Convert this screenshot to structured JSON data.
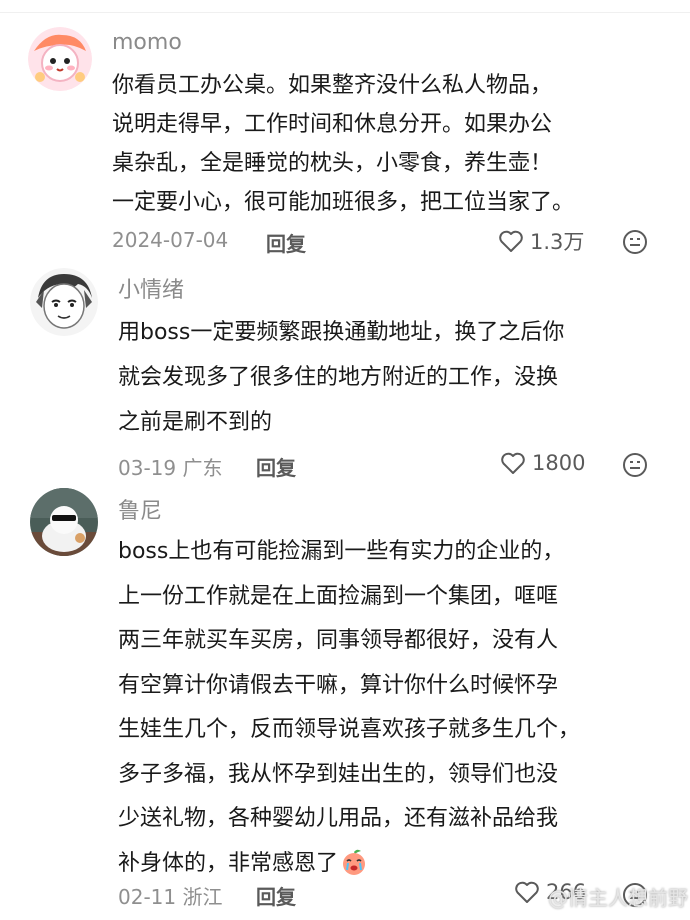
{
  "comments": [
    {
      "username": "momo",
      "lines": [
        "你看员工办公桌。如果整齐没什么私人物品，",
        "说明走得早，工作时间和休息分开。如果办公",
        "桌杂乱，全是睡觉的枕头，小零食，养生壶！",
        "一定要小心，很可能加班很多，把工位当家了。"
      ],
      "meta": "2024-07-04",
      "reply_label": "回复",
      "likes": "1.3万"
    },
    {
      "username": "小情绪",
      "lines": [
        "用boss一定要频繁跟换通勤地址，换了之后你",
        "就会发现多了很多住的地方附近的工作，没换",
        "之前是刷不到的"
      ],
      "meta": "03-19 广东",
      "reply_label": "回复",
      "likes": "1800"
    },
    {
      "username": "鲁尼",
      "lines": [
        "boss上也有可能捡漏到一些有实力的企业的，",
        "上一份工作就是在上面捡漏到一个集团，哐哐",
        "两三年就买车买房，同事领导都很好，没有人",
        "有空算计你请假去干嘛，算计你什么时候怀孕",
        "生娃生几个，反而领导说喜欢孩子就多生几个，",
        "多子多福，我从怀孕到娃出生的，领导们也没",
        "少送礼物，各种婴幼儿用品，还有滋补品给我",
        "补身体的，非常感恩了"
      ],
      "meta": "02-11 浙江",
      "reply_label": "回复",
      "likes": "266"
    }
  ],
  "watermark": "@情主人想前野",
  "icons": {
    "like": "heart-outline-icon",
    "dislike": "dislike-face-icon",
    "emoji": "crying-peach-emoji"
  },
  "colors": {
    "text": "#1a1a1a",
    "username": "#8a8a8a",
    "meta": "#8f8f8f",
    "reply": "#5a5a5a"
  }
}
